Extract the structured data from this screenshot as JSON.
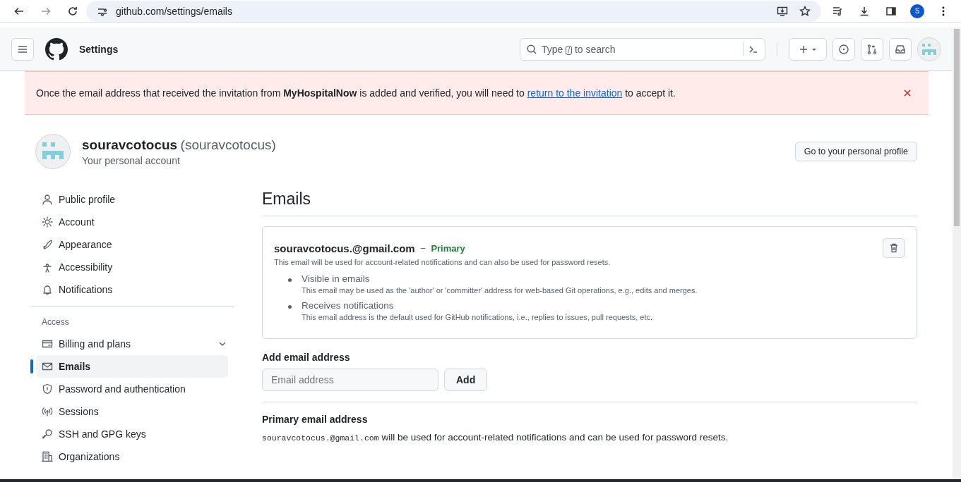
{
  "browser": {
    "url": "github.com/settings/emails",
    "profile_initial": "S"
  },
  "header": {
    "title": "Settings",
    "search": {
      "before": "Type",
      "key": "/",
      "after": "to search"
    }
  },
  "banner": {
    "before": "Once the email address that received the invitation from **MyHospitalNow** is added and verified, you will need to",
    "link": "return to the invitation",
    "after": "to accept it."
  },
  "profile": {
    "name": "souravcotocus",
    "handle": "(souravcotocus)",
    "subtitle": "Your personal account",
    "button": "Go to your personal profile"
  },
  "sidebar": {
    "groups": [
      {
        "items": [
          {
            "label": "Public profile",
            "selected": false,
            "collapsible": false
          },
          {
            "label": "Account",
            "selected": false,
            "collapsible": false
          },
          {
            "label": "Appearance",
            "selected": false,
            "collapsible": false
          },
          {
            "label": "Accessibility",
            "selected": false,
            "collapsible": false
          },
          {
            "label": "Notifications",
            "selected": false,
            "collapsible": false
          }
        ]
      },
      {
        "heading": "Access",
        "items": [
          {
            "label": "Billing and plans",
            "selected": false,
            "collapsible": true
          },
          {
            "label": "Emails",
            "selected": true,
            "collapsible": false
          },
          {
            "label": "Password and authentication",
            "selected": false,
            "collapsible": false
          },
          {
            "label": "Sessions",
            "selected": false,
            "collapsible": false
          },
          {
            "label": "SSH and GPG keys",
            "selected": false,
            "collapsible": false
          },
          {
            "label": "Organizations",
            "selected": false,
            "collapsible": false
          }
        ]
      }
    ]
  },
  "emails": {
    "heading": "Emails",
    "entries": [
      {
        "address": "souravcotocus.@gmail.com",
        "separator": "–",
        "badge": "Primary",
        "description": "This email will be used for account-related notifications and can also be used for password resets.",
        "bullets": [
          {
            "title": "Visible in emails",
            "text": "This email may be used as the 'author' or 'committer' address for web-based Git operations, e.g., edits and merges."
          },
          {
            "title": "Receives notifications",
            "text": "This email address is the default used for GitHub notifications, i.e., replies to issues, pull requests, etc."
          }
        ]
      }
    ]
  },
  "add_email": {
    "label": "Add email address",
    "placeholder": "Email address",
    "button": "Add"
  },
  "primary_email": {
    "heading": "Primary email address",
    "address": "souravcotocus.@gmail.com",
    "text": "will be used for account-related notifications and can be used for password resets."
  }
}
